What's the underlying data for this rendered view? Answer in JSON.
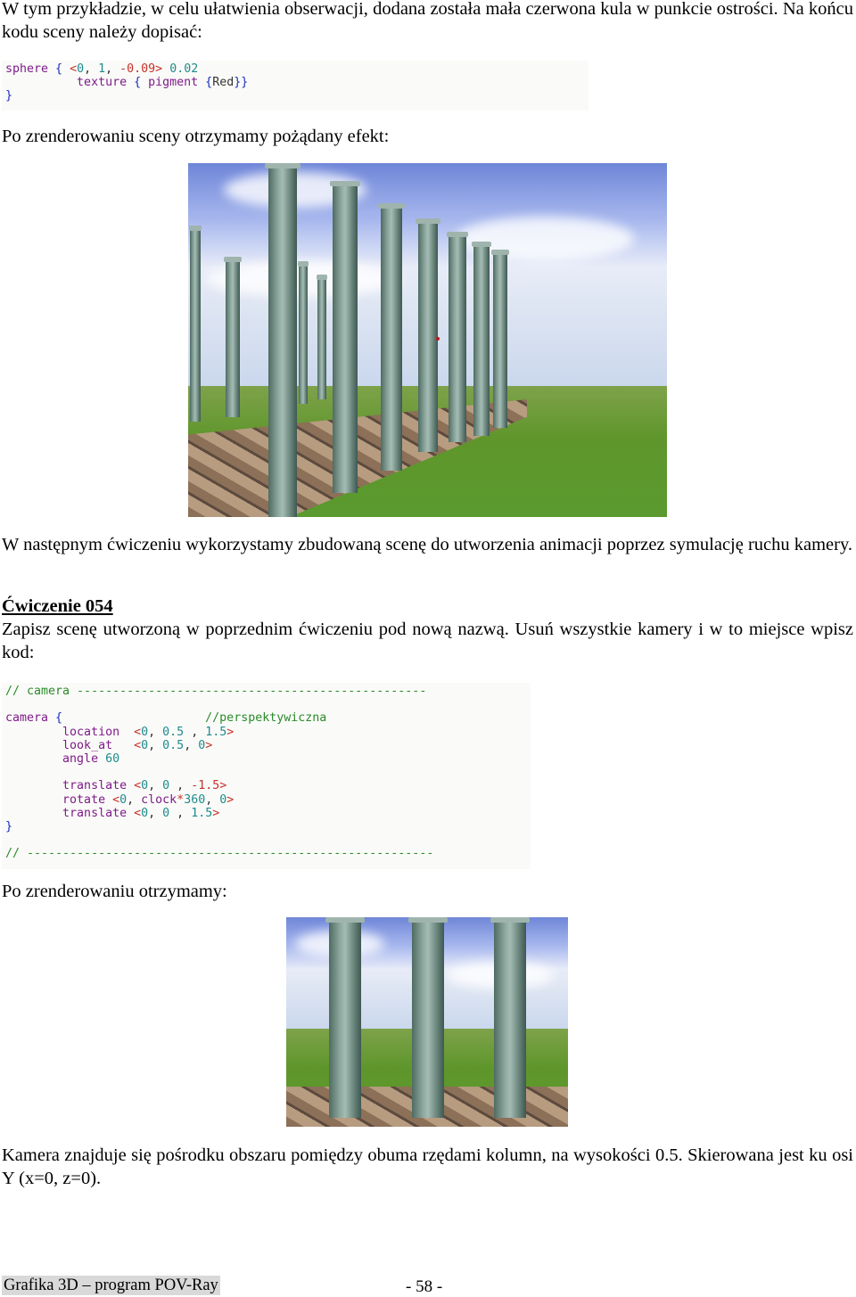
{
  "intro": {
    "text": "W tym przykładzie, w celu ułatwienia obserwacji, dodana została mała czerwona kula w punkcie ostrości. Na końcu kodu sceny należy dopisać:"
  },
  "code1": {
    "lines": [
      [
        {
          "t": "sphere ",
          "c": "kw"
        },
        {
          "t": "{ ",
          "c": "br"
        },
        {
          "t": "<",
          "c": "ang"
        },
        {
          "t": "0",
          "c": "num"
        },
        {
          "t": ", ",
          "c": "tx"
        },
        {
          "t": "1",
          "c": "num"
        },
        {
          "t": ", ",
          "c": "tx"
        },
        {
          "t": "-0.09",
          "c": "ang"
        },
        {
          "t": "> ",
          "c": "ang"
        },
        {
          "t": "0.02",
          "c": "num"
        }
      ],
      [
        {
          "t": "          texture ",
          "c": "kw"
        },
        {
          "t": "{ ",
          "c": "br"
        },
        {
          "t": "pigment ",
          "c": "kw"
        },
        {
          "t": "{",
          "c": "br"
        },
        {
          "t": "Red",
          "c": "tx"
        },
        {
          "t": "}}",
          "c": "br"
        }
      ],
      [
        {
          "t": "}",
          "c": "br"
        }
      ]
    ]
  },
  "after_render_1": "Po zrenderowaniu sceny otrzymamy pożądany efekt:",
  "paragraph_next": "W następnym ćwiczeniu wykorzystamy zbudowaną scenę do utworzenia animacji poprzez symulację ruchu kamery.",
  "exercise": {
    "title": "Ćwiczenie 054",
    "text": "Zapisz scenę utworzoną w poprzednim ćwiczeniu pod nową nazwą. Usuń wszystkie kamery i w to miejsce wpisz kod:"
  },
  "code2": {
    "lines": [
      [
        {
          "t": "// camera -------------------------------------------------",
          "c": "cm"
        }
      ],
      [
        {
          "t": "",
          "c": "tx"
        }
      ],
      [
        {
          "t": "camera ",
          "c": "kw"
        },
        {
          "t": "{",
          "c": "br"
        },
        {
          "t": "                    //perspektywiczna",
          "c": "cm"
        }
      ],
      [
        {
          "t": "        location  ",
          "c": "kw"
        },
        {
          "t": "<",
          "c": "ang"
        },
        {
          "t": "0",
          "c": "num"
        },
        {
          "t": ", ",
          "c": "tx"
        },
        {
          "t": "0.5",
          "c": "num"
        },
        {
          "t": " , ",
          "c": "tx"
        },
        {
          "t": "1.5",
          "c": "num"
        },
        {
          "t": ">",
          "c": "ang"
        }
      ],
      [
        {
          "t": "        look_at   ",
          "c": "kw"
        },
        {
          "t": "<",
          "c": "ang"
        },
        {
          "t": "0",
          "c": "num"
        },
        {
          "t": ", ",
          "c": "tx"
        },
        {
          "t": "0.5",
          "c": "num"
        },
        {
          "t": ", ",
          "c": "tx"
        },
        {
          "t": "0",
          "c": "num"
        },
        {
          "t": ">",
          "c": "ang"
        }
      ],
      [
        {
          "t": "        angle ",
          "c": "kw"
        },
        {
          "t": "60",
          "c": "num"
        }
      ],
      [
        {
          "t": "",
          "c": "tx"
        }
      ],
      [
        {
          "t": "        translate ",
          "c": "kw"
        },
        {
          "t": "<",
          "c": "ang"
        },
        {
          "t": "0",
          "c": "num"
        },
        {
          "t": ", ",
          "c": "tx"
        },
        {
          "t": "0",
          "c": "num"
        },
        {
          "t": " , ",
          "c": "tx"
        },
        {
          "t": "-1.5",
          "c": "ang"
        },
        {
          "t": ">",
          "c": "ang"
        }
      ],
      [
        {
          "t": "        rotate ",
          "c": "kw"
        },
        {
          "t": "<",
          "c": "ang"
        },
        {
          "t": "0",
          "c": "num"
        },
        {
          "t": ", ",
          "c": "tx"
        },
        {
          "t": "clock",
          "c": "kw"
        },
        {
          "t": "*",
          "c": "ang"
        },
        {
          "t": "360",
          "c": "num"
        },
        {
          "t": ", ",
          "c": "tx"
        },
        {
          "t": "0",
          "c": "num"
        },
        {
          "t": ">",
          "c": "ang"
        }
      ],
      [
        {
          "t": "        translate ",
          "c": "kw"
        },
        {
          "t": "<",
          "c": "ang"
        },
        {
          "t": "0",
          "c": "num"
        },
        {
          "t": ", ",
          "c": "tx"
        },
        {
          "t": "0",
          "c": "num"
        },
        {
          "t": " , ",
          "c": "tx"
        },
        {
          "t": "1.5",
          "c": "num"
        },
        {
          "t": ">",
          "c": "ang"
        }
      ],
      [
        {
          "t": "}",
          "c": "br"
        }
      ],
      [
        {
          "t": "",
          "c": "tx"
        }
      ],
      [
        {
          "t": "// ---------------------------------------------------------",
          "c": "cm"
        }
      ]
    ]
  },
  "after_render_2": "Po zrenderowaniu otrzymamy:",
  "conclusion": "Kamera znajduje się pośrodku obszaru pomiędzy obuma rzędami kolumn, na wysokości 0.5. Skierowana jest ku osi Y (x=0, z=0).",
  "footer": {
    "title": "Grafika 3D – program POV-Ray",
    "page": "- 58 -"
  }
}
